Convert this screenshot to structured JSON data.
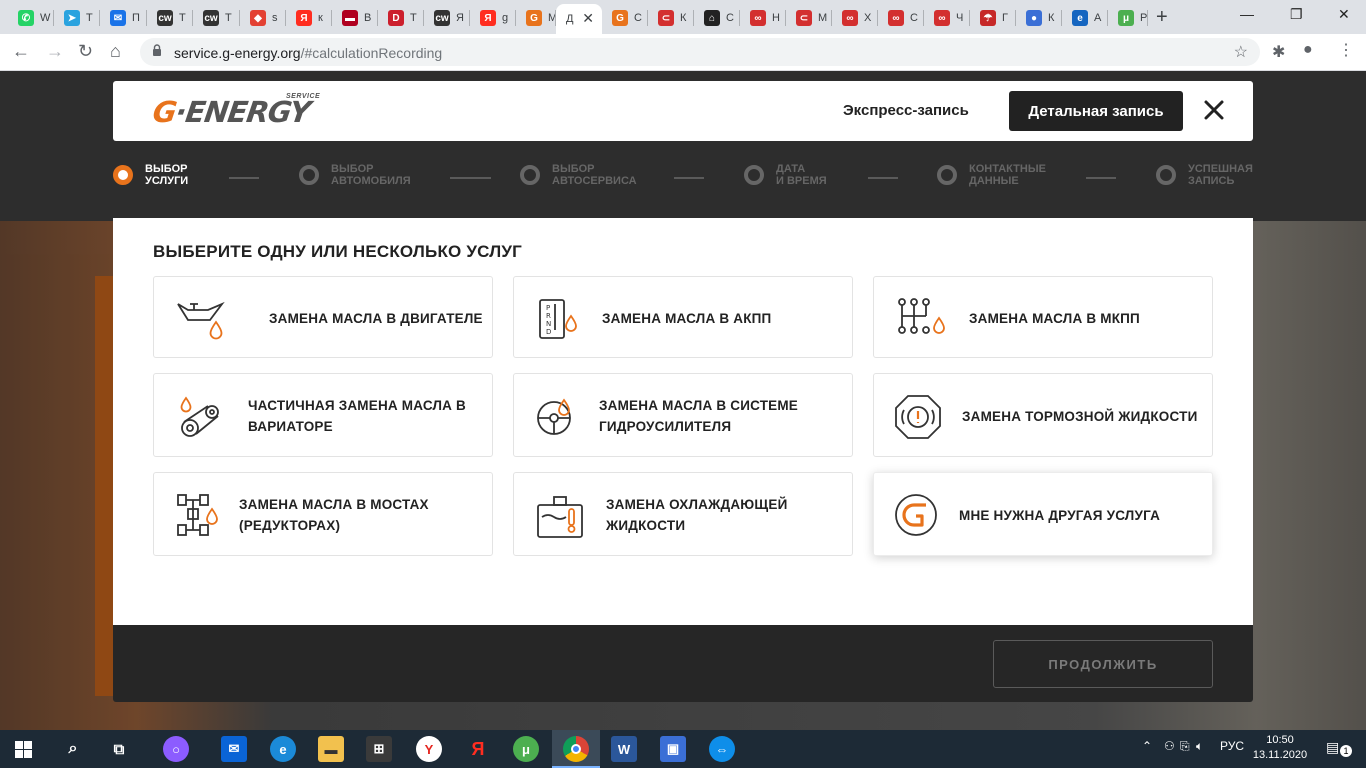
{
  "browser": {
    "tabs": [
      {
        "label": "W",
        "color": "#25d366",
        "glyph": "✆"
      },
      {
        "label": "Т",
        "color": "#2aa3df",
        "glyph": "➤"
      },
      {
        "label": "П",
        "color": "#1a73e8",
        "glyph": "✉"
      },
      {
        "label": "Т",
        "color": "#333333",
        "glyph": "cw"
      },
      {
        "label": "Т",
        "color": "#333333",
        "glyph": "cw"
      },
      {
        "label": "s",
        "color": "#e34133",
        "glyph": "◆"
      },
      {
        "label": "к",
        "color": "#ff2d20",
        "glyph": "Я"
      },
      {
        "label": "В",
        "color": "#b00020",
        "glyph": "▬"
      },
      {
        "label": "Т",
        "color": "#cc1f2d",
        "glyph": "D"
      },
      {
        "label": "Я",
        "color": "#333333",
        "glyph": "cw"
      },
      {
        "label": "g",
        "color": "#ff2d20",
        "glyph": "Я"
      },
      {
        "label": "M",
        "color": "#e8731c",
        "glyph": "G"
      },
      {
        "label": "Д",
        "color": "#ffffff",
        "glyph": ""
      },
      {
        "label": "С",
        "color": "#e8731c",
        "glyph": "G"
      },
      {
        "label": "К",
        "color": "#d32f2f",
        "glyph": "⊂"
      },
      {
        "label": "С",
        "color": "#222222",
        "glyph": "⌂"
      },
      {
        "label": "Н",
        "color": "#d32f2f",
        "glyph": "∞"
      },
      {
        "label": "М",
        "color": "#d32f2f",
        "glyph": "⊂"
      },
      {
        "label": "Х",
        "color": "#d32f2f",
        "glyph": "∞"
      },
      {
        "label": "С",
        "color": "#d32f2f",
        "glyph": "∞"
      },
      {
        "label": "Ч",
        "color": "#d32f2f",
        "glyph": "∞"
      },
      {
        "label": "Г",
        "color": "#c62828",
        "glyph": "☂"
      },
      {
        "label": "К",
        "color": "#3b6fd6",
        "glyph": "●"
      },
      {
        "label": "А",
        "color": "#1565c0",
        "glyph": "e"
      },
      {
        "label": "Р",
        "color": "#4caf50",
        "glyph": "μ"
      }
    ],
    "active_tab_close": "✕",
    "new_tab": "+",
    "url_host": "service.g-energy.org",
    "url_path": "/#calculationRecording"
  },
  "header": {
    "logo_text_g": "G",
    "logo_text_rest": "·ENERGY",
    "logo_service": "SERVICE",
    "express_label": "Экспресс-запись",
    "detail_label": "Детальная запись"
  },
  "steps": [
    {
      "line1": "ВЫБОР",
      "line2": "УСЛУГИ",
      "active": true
    },
    {
      "line1": "ВЫБОР",
      "line2": "АВТОМОБИЛЯ",
      "active": false
    },
    {
      "line1": "ВЫБОР",
      "line2": "АВТОСЕРВИСА",
      "active": false
    },
    {
      "line1": "ДАТА",
      "line2": "И ВРЕМЯ",
      "active": false
    },
    {
      "line1": "КОНТАКТНЫЕ",
      "line2": "ДАННЫЕ",
      "active": false
    },
    {
      "line1": "УСПЕШНАЯ",
      "line2": "ЗАПИСЬ",
      "active": false
    }
  ],
  "services": {
    "title": "ВЫБЕРИТЕ ОДНУ ИЛИ НЕСКОЛЬКО УСЛУГ",
    "items": [
      {
        "line1": "ЗАМЕНА МАСЛА В ДВИГАТЕЛЕ",
        "line2": "",
        "icon": "oil-can-icon"
      },
      {
        "line1": "ЗАМЕНА МАСЛА В АКПП",
        "line2": "",
        "icon": "automatic-gearbox-icon"
      },
      {
        "line1": "ЗАМЕНА МАСЛА В МКПП",
        "line2": "",
        "icon": "manual-gearbox-icon"
      },
      {
        "line1": "ЧАСТИЧНАЯ ЗАМЕНА МАСЛА В",
        "line2": "ВАРИАТОРЕ",
        "icon": "variator-belt-icon"
      },
      {
        "line1": "ЗАМЕНА МАСЛА В СИСТЕМЕ",
        "line2": "ГИДРОУСИЛИТЕЛЯ",
        "icon": "steering-wheel-icon"
      },
      {
        "line1": "ЗАМЕНА ТОРМОЗНОЙ ЖИДКОСТИ",
        "line2": "",
        "icon": "brake-warning-icon"
      },
      {
        "line1": "ЗАМЕНА МАСЛА В МОСТАХ",
        "line2": "(РЕДУКТОРАХ)",
        "icon": "axle-chassis-icon"
      },
      {
        "line1": "ЗАМЕНА ОХЛАЖДАЮЩЕЙ",
        "line2": "ЖИДКОСТИ",
        "icon": "coolant-tank-icon"
      },
      {
        "line1": "МНЕ НУЖНА ДРУГАЯ УСЛУГА",
        "line2": "",
        "icon": "g-energy-logo-icon"
      }
    ]
  },
  "footer": {
    "continue_label": "ПРОДОЛЖИТЬ"
  },
  "taskbar": {
    "lang": "РУС",
    "time": "10:50",
    "date": "13.11.2020",
    "notifications": "1"
  }
}
